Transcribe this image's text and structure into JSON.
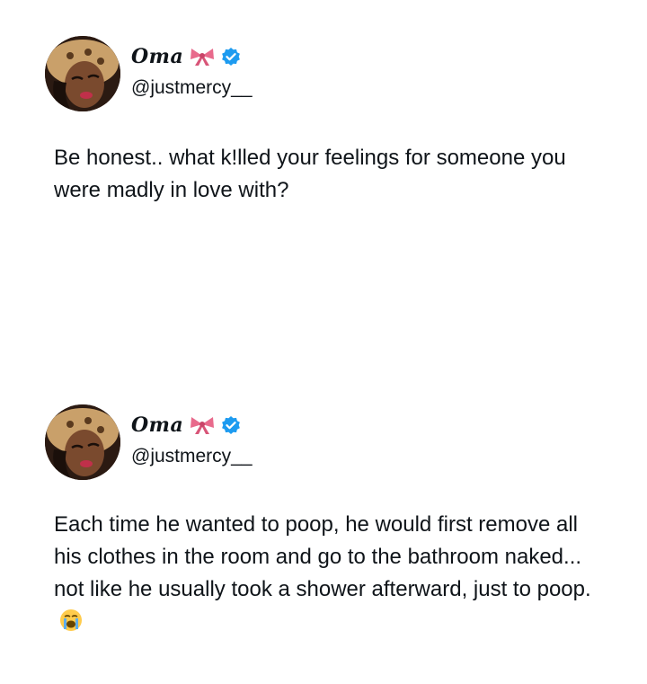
{
  "tweets": [
    {
      "author": {
        "display_name": "Oma",
        "handle": "@justmercy__",
        "emoji": "bow-icon",
        "verified": true
      },
      "text": "Be honest.. what k!lled your feelings for someone you were madly in love with?"
    },
    {
      "author": {
        "display_name": "Oma",
        "handle": "@justmercy__",
        "emoji": "bow-icon",
        "verified": true
      },
      "text": "Each time he wanted to poop, he would first remove all his clothes in the room and go to the bathroom naked... not like he usually took a shower afterward, just to poop.",
      "trailing_emoji": "loudly-crying-face-icon"
    }
  ],
  "colors": {
    "verified": "#1d9bf0",
    "bow": "#e86a8c",
    "text": "#0f1419"
  }
}
